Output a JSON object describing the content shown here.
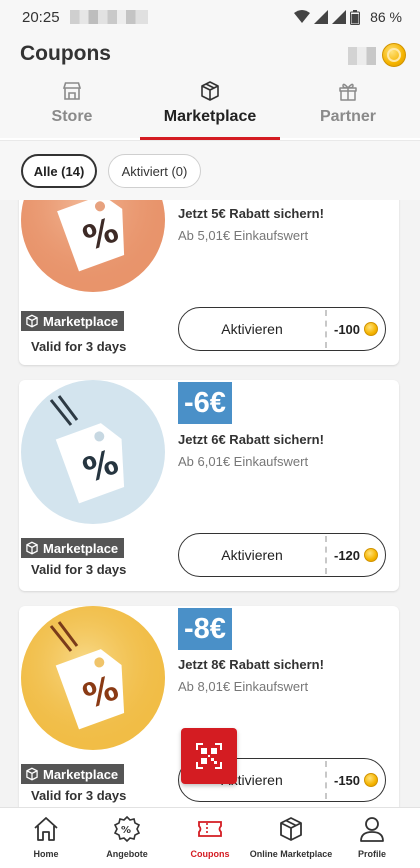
{
  "status_bar": {
    "time": "20:25",
    "battery": "86 %"
  },
  "header": {
    "title": "Coupons"
  },
  "tabs": [
    {
      "label": "Store",
      "icon": "store-icon",
      "active": false
    },
    {
      "label": "Marketplace",
      "icon": "box-icon",
      "active": true
    },
    {
      "label": "Partner",
      "icon": "gift-icon",
      "active": false
    }
  ],
  "filters": [
    {
      "label": "Alle (14)",
      "selected": true
    },
    {
      "label": "Aktiviert (0)",
      "selected": false
    }
  ],
  "coupons": [
    {
      "badge": "",
      "headline": "Jetzt 5€ Rabatt sichern!",
      "subtitle": "Ab 5,01€ Einkaufswert",
      "tag": "Marketplace",
      "validity": "Valid for 3 days",
      "button": "Aktivieren",
      "cost": "-100",
      "color": "#e8916a",
      "symbol": "%"
    },
    {
      "badge": "-6€",
      "headline": "Jetzt 6€ Rabatt sichern!",
      "subtitle": "Ab 6,01€ Einkaufswert",
      "tag": "Marketplace",
      "validity": "Valid for 3 days",
      "button": "Aktivieren",
      "cost": "-120",
      "color": "#cfe0ea",
      "symbol": "%"
    },
    {
      "badge": "-8€",
      "headline": "Jetzt 8€ Rabatt sichern!",
      "subtitle": "Ab 8,01€ Einkaufswert",
      "tag": "Marketplace",
      "validity": "Valid for 3 days",
      "button": "Aktivieren",
      "cost": "-150",
      "color": "#f2c14e",
      "symbol": "%"
    }
  ],
  "bottom_nav": [
    {
      "label": "Home",
      "icon": "home-icon",
      "active": false
    },
    {
      "label": "Angebote",
      "icon": "offers-icon",
      "active": false
    },
    {
      "label": "Coupons",
      "icon": "coupons-icon",
      "active": true
    },
    {
      "label": "Online Marketplace",
      "icon": "box-icon",
      "active": false
    },
    {
      "label": "Profile",
      "icon": "profile-icon",
      "active": false
    }
  ],
  "colors": {
    "accent": "#d41c22",
    "badge": "#4a90c8",
    "coin": "#f5b400"
  }
}
